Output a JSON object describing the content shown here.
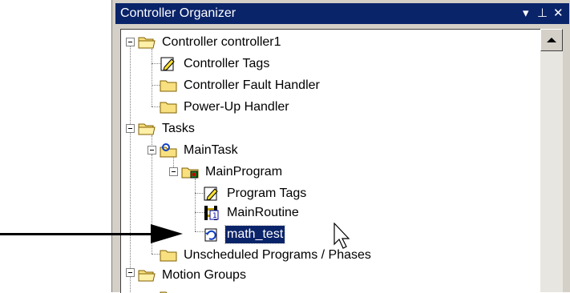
{
  "panel": {
    "title": "Controller Organizer",
    "pin_glyph": "▾ ⊥",
    "close_glyph": "✕"
  },
  "tree": {
    "items": [
      {
        "label": "Controller controller1",
        "icon": "folder-icon",
        "expanded": true
      },
      {
        "label": "Controller Tags",
        "icon": "tags-icon"
      },
      {
        "label": "Controller Fault Handler",
        "icon": "folder-icon"
      },
      {
        "label": "Power-Up Handler",
        "icon": "folder-icon"
      },
      {
        "label": "Tasks",
        "icon": "folder-icon",
        "expanded": true
      },
      {
        "label": "MainTask",
        "icon": "task-icon",
        "expanded": true
      },
      {
        "label": "MainProgram",
        "icon": "program-icon",
        "expanded": true
      },
      {
        "label": "Program Tags",
        "icon": "tags-icon"
      },
      {
        "label": "MainRoutine",
        "icon": "main-routine-icon"
      },
      {
        "label": "math_test",
        "icon": "routine-icon",
        "selected": true
      },
      {
        "label": "Unscheduled Programs / Phases",
        "icon": "folder-icon"
      },
      {
        "label": "Motion Groups",
        "icon": "folder-icon",
        "expanded": true
      }
    ]
  },
  "colors": {
    "title_bg": "#0a246a",
    "panel_bg": "#d4d0c8",
    "folder": "#f8e080",
    "selection": "#0a246a"
  }
}
